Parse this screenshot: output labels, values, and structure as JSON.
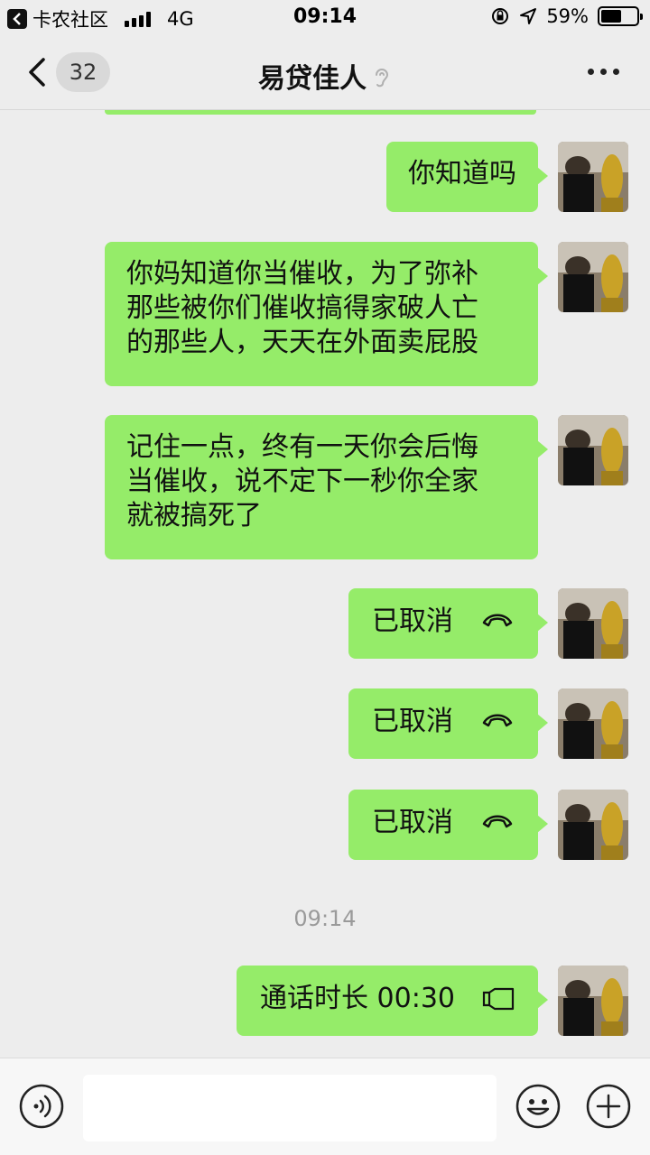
{
  "status_bar": {
    "back_app_label": "卡农社区",
    "network": "4G",
    "time": "09:14",
    "battery_percent": "59%",
    "battery_level": 0.59
  },
  "nav": {
    "unread_count": "32",
    "title": "易贷佳人"
  },
  "messages": [
    {
      "text": "你知道吗"
    },
    {
      "lines": [
        "你妈知道你当催收，为了弥补",
        "那些被你们催收搞得家破人亡",
        "的那些人，天天在外面卖屁股"
      ]
    },
    {
      "lines": [
        "记住一点，终有一天你会后悔",
        "当催收，说不定下一秒你全家",
        "就被搞死了"
      ]
    },
    {
      "text": "已取消",
      "icon": "hangup-phone-icon"
    },
    {
      "text": "已取消",
      "icon": "hangup-phone-icon"
    },
    {
      "text": "已取消",
      "icon": "hangup-phone-icon"
    },
    {
      "text": "通话时长 00:30",
      "icon": "phone-call-icon"
    }
  ],
  "timestamp": "09:14",
  "input": {
    "value": "",
    "placeholder": ""
  },
  "colors": {
    "bubble": "#95ec69",
    "background": "#ededed"
  }
}
